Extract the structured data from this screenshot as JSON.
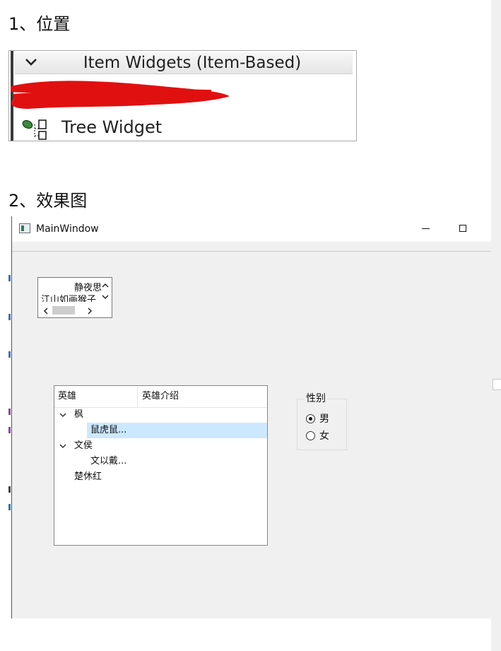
{
  "headings": {
    "position": "1、位置",
    "result": "2、效果图"
  },
  "widget_box": {
    "category": "Item Widgets (Item-Based)",
    "items": [
      {
        "label": "Tree Widget"
      }
    ]
  },
  "window": {
    "title": "MainWindow",
    "list_widget": {
      "items": [
        "静夜思",
        "江山如画猴子"
      ]
    },
    "tree_widget": {
      "columns": [
        "英雄",
        "英雄介绍"
      ],
      "rows": [
        {
          "text": "枫",
          "expanded": true
        },
        {
          "text": "鼠虎鼠...",
          "selected": true
        },
        {
          "text": "文侯",
          "expanded": true
        },
        {
          "text": "文以戴..."
        },
        {
          "text": "楚休红"
        }
      ]
    },
    "gender_group": {
      "title": "性别",
      "options": [
        {
          "label": "男",
          "checked": true
        },
        {
          "label": "女",
          "checked": false
        }
      ]
    }
  },
  "colors": {
    "selection": "#cce8ff",
    "window_bg": "#f0f0f0",
    "redaction": "#e01010"
  }
}
